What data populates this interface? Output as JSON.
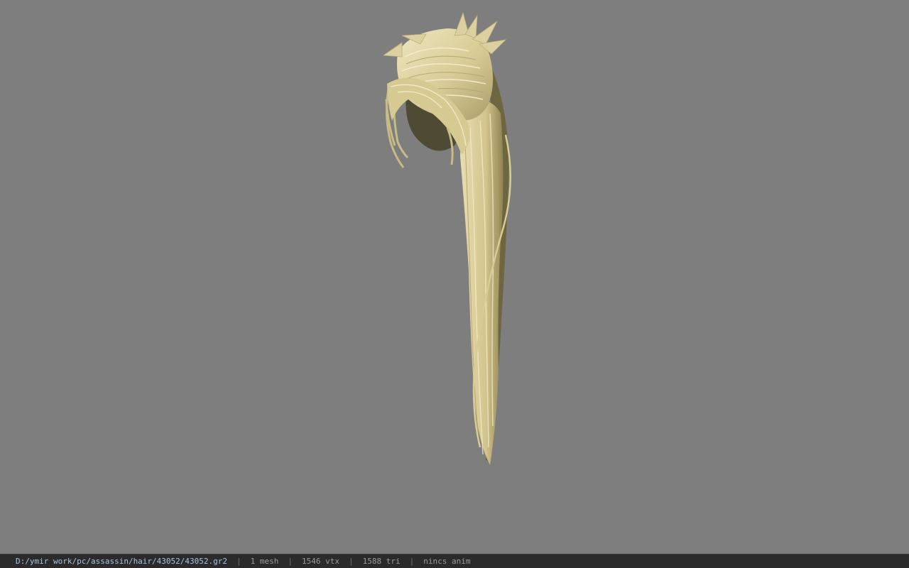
{
  "viewport": {
    "background": "#7e7e7e",
    "model_name": "hair-model",
    "hair_light": "#e2d7a8",
    "hair_mid": "#c9bb85",
    "hair_shadow": "#5e5636"
  },
  "status_bar": {
    "file_path": "D:/ymir work/pc/assassin/hair/43052/43052.gr2",
    "separator": "|",
    "mesh_count": "1 mesh",
    "vertex_count": "1546 vtx",
    "triangle_count": "1588 tri",
    "anim_status": "nincs anim",
    "path_color": "#a8c4e0",
    "background": "#2b2b2b"
  }
}
